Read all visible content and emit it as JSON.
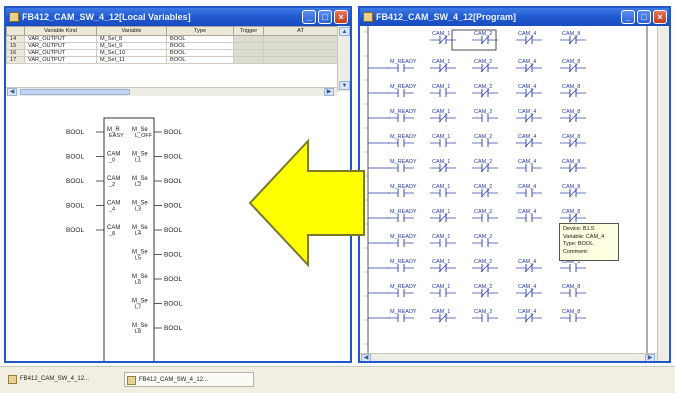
{
  "left_window": {
    "title": "FB412_CAM_SW_4_12[Local Variables]",
    "columns": [
      "",
      "Variable Kind",
      "Variable",
      "Type",
      "Trigger",
      "AT"
    ],
    "rows": [
      {
        "num": "14",
        "kind": "VAR_OUTPUT",
        "variable": "M_Sel_8",
        "type": "BOOL"
      },
      {
        "num": "15",
        "kind": "VAR_OUTPUT",
        "variable": "M_Sel_9",
        "type": "BOOL"
      },
      {
        "num": "16",
        "kind": "VAR_OUTPUT",
        "variable": "M_Sel_10",
        "type": "BOOL"
      },
      {
        "num": "17",
        "kind": "VAR_OUTPUT",
        "variable": "M_Sel_11",
        "type": "BOOL"
      }
    ],
    "fb": {
      "input_type": "BOOL",
      "output_type": "BOOL",
      "inputs": [
        {
          "name": "M_R",
          "sub": "EASY"
        },
        {
          "name": "CAM",
          "sub": "_0"
        },
        {
          "name": "CAM",
          "sub": "_2"
        },
        {
          "name": "CAM",
          "sub": "_4"
        },
        {
          "name": "CAM",
          "sub": "_8"
        }
      ],
      "outputs": [
        {
          "name": "M_Se",
          "sub": "L_OFF"
        },
        {
          "name": "M_Se",
          "sub": "L1"
        },
        {
          "name": "M_Se",
          "sub": "L2"
        },
        {
          "name": "M_Se",
          "sub": "L3"
        },
        {
          "name": "M_Se",
          "sub": "L4"
        },
        {
          "name": "M_Se",
          "sub": "L5"
        },
        {
          "name": "M_Se",
          "sub": "L6"
        },
        {
          "name": "M_Se",
          "sub": "L7"
        },
        {
          "name": "M_Se",
          "sub": "L8"
        }
      ]
    }
  },
  "right_window": {
    "title": "FB412_CAM_SW_4_12[Program]",
    "first_row": [
      "CAM_1",
      "CAM_2",
      "CAM_4",
      "CAM_8"
    ],
    "row_contacts": [
      "M_READY",
      "CAM_1",
      "CAM_2",
      "CAM_4",
      "CAM_8"
    ],
    "tooltip": [
      "Device: B1.5",
      "Variable: CAM_4",
      "Type: BOOL",
      "Comment:"
    ]
  },
  "taskbar": {
    "items": [
      "FB412_CAM_SW_4_12...",
      "FB412_CAM_SW_4_12..."
    ]
  },
  "colors": {
    "title_bar": "#1f57cf",
    "arrow_fill": "#ffff00",
    "arrow_stroke": "#7a7a2a",
    "ladder_blue": "#2a3aa8"
  }
}
